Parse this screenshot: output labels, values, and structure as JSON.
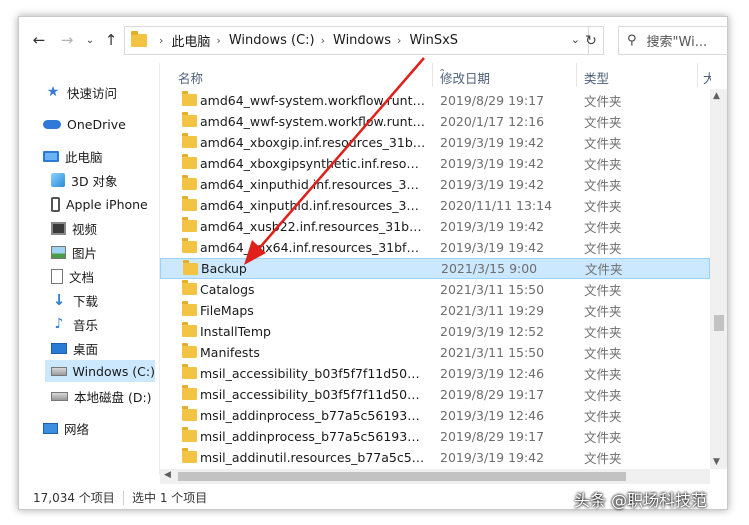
{
  "nav": {
    "back_icon": "back-arrow-icon",
    "forward_icon": "forward-arrow-icon",
    "dropdown_icon": "chevron-down-icon",
    "up_icon": "up-arrow-icon"
  },
  "address": {
    "crumbs": [
      "此电脑",
      "Windows (C:)",
      "Windows",
      "WinSxS"
    ]
  },
  "search": {
    "placeholder": "搜索\"Wi..."
  },
  "sidebar": {
    "items": [
      {
        "label": "快速访问",
        "icon": "star-icon"
      },
      {
        "label": "OneDrive",
        "icon": "cloud-icon"
      },
      {
        "label": "此电脑",
        "icon": "computer-icon"
      },
      {
        "label": "3D 对象",
        "icon": "cube-icon"
      },
      {
        "label": "Apple iPhone",
        "icon": "phone-icon"
      },
      {
        "label": "视频",
        "icon": "video-icon"
      },
      {
        "label": "图片",
        "icon": "picture-icon"
      },
      {
        "label": "文档",
        "icon": "document-icon"
      },
      {
        "label": "下载",
        "icon": "download-icon"
      },
      {
        "label": "音乐",
        "icon": "music-icon"
      },
      {
        "label": "桌面",
        "icon": "desktop-icon"
      },
      {
        "label": "Windows (C:)",
        "icon": "drive-icon"
      },
      {
        "label": "本地磁盘 (D:)",
        "icon": "drive-icon"
      },
      {
        "label": "网络",
        "icon": "network-icon"
      }
    ],
    "selected_index": 11
  },
  "columns": {
    "name": "名称",
    "date": "修改日期",
    "type": "类型",
    "size": "大"
  },
  "rows": [
    {
      "name": "amd64_wwf-system.workflow.runtime...",
      "date": "2019/8/29 19:17",
      "type": "文件夹"
    },
    {
      "name": "amd64_wwf-system.workflow.runtime...",
      "date": "2020/1/17 12:16",
      "type": "文件夹"
    },
    {
      "name": "amd64_xboxgip.inf.resources_31bf38...",
      "date": "2019/3/19 19:42",
      "type": "文件夹"
    },
    {
      "name": "amd64_xboxgipsynthetic.inf.resource...",
      "date": "2019/3/19 19:42",
      "type": "文件夹"
    },
    {
      "name": "amd64_xinputhid.inf.resources_31bf3...",
      "date": "2019/3/19 19:42",
      "type": "文件夹"
    },
    {
      "name": "amd64_xinputhid.inf.resources_31bf3...",
      "date": "2020/11/11 13:14",
      "type": "文件夹"
    },
    {
      "name": "amd64_xusb22.inf.resources_31bf385...",
      "date": "2019/3/19 19:42",
      "type": "文件夹"
    },
    {
      "name": "amd64_ynx64.inf.resources_31bf385...",
      "date": "2019/3/19 19:42",
      "type": "文件夹"
    },
    {
      "name": "Backup",
      "date": "2021/3/15 9:00",
      "type": "文件夹"
    },
    {
      "name": "Catalogs",
      "date": "2021/3/11 15:50",
      "type": "文件夹"
    },
    {
      "name": "FileMaps",
      "date": "2021/3/11 19:29",
      "type": "文件夹"
    },
    {
      "name": "InstallTemp",
      "date": "2019/3/19 12:52",
      "type": "文件夹"
    },
    {
      "name": "Manifests",
      "date": "2021/3/11 15:50",
      "type": "文件夹"
    },
    {
      "name": "msil_accessibility_b03f5f7f11d50a3a_...",
      "date": "2019/3/19 12:46",
      "type": "文件夹"
    },
    {
      "name": "msil_accessibility_b03f5f7f11d50a3a_...",
      "date": "2019/8/29 19:17",
      "type": "文件夹"
    },
    {
      "name": "msil_addinprocess_b77a5c561934e08...",
      "date": "2019/3/19 12:46",
      "type": "文件夹"
    },
    {
      "name": "msil_addinprocess_b77a5c561934e08...",
      "date": "2019/8/29 19:17",
      "type": "文件夹"
    },
    {
      "name": "msil_addinutil.resources_b77a5c5619...",
      "date": "2019/3/19 19:42",
      "type": "文件夹"
    }
  ],
  "selected_row_index": 8,
  "status": {
    "count": "17,034 个项目",
    "selection": "选中 1 个项目"
  },
  "watermark": "头条 @职场科技范",
  "colors": {
    "selection": "#cce8ff",
    "folder": "#f3c443",
    "arrow": "#e0201b"
  }
}
